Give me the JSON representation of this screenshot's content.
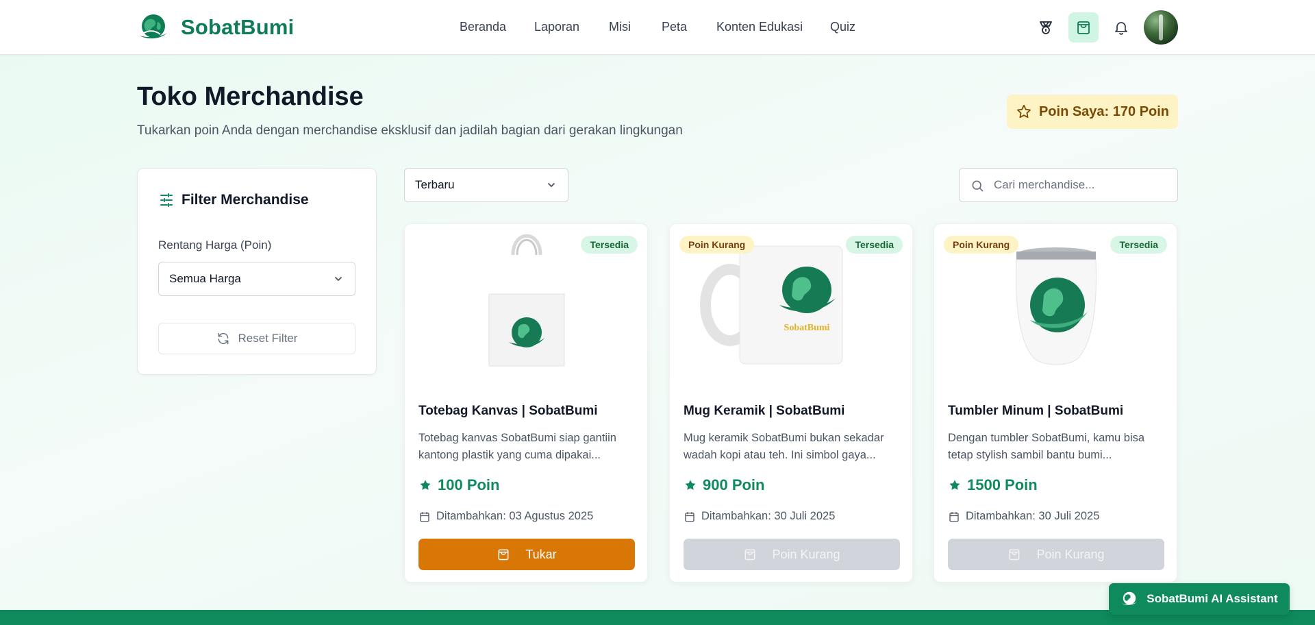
{
  "brand": {
    "name": "SobatBumi",
    "color": "#0e7c55"
  },
  "nav": {
    "items": [
      {
        "label": "Beranda"
      },
      {
        "label": "Laporan"
      },
      {
        "label": "Misi"
      },
      {
        "label": "Peta"
      },
      {
        "label": "Konten Edukasi"
      },
      {
        "label": "Quiz"
      }
    ]
  },
  "header_icons": [
    "badge-icon",
    "shopping-bag-icon",
    "bell-icon",
    "avatar"
  ],
  "page": {
    "title": "Toko Merchandise",
    "subtitle": "Tukarkan poin Anda dengan merchandise eksklusif dan jadilah bagian dari gerakan lingkungan",
    "points_label": "Poin Saya: 170 Poin"
  },
  "filter": {
    "title": "Filter Merchandise",
    "price_label": "Rentang Harga (Poin)",
    "price_value": "Semua Harga",
    "reset_label": "Reset Filter"
  },
  "sort": {
    "value": "Terbaru"
  },
  "search": {
    "placeholder": "Cari merchandise..."
  },
  "products": [
    {
      "name": "Totebag Kanvas | SobatBumi",
      "desc": "Totebag kanvas SobatBumi siap gantiin kantong plastik yang cuma dipakai...",
      "price": "100 Poin",
      "date": "Ditambahkan: 03 Agustus 2025",
      "status": "Tersedia",
      "warning": "",
      "button": "Tukar",
      "image": "totebag"
    },
    {
      "name": "Mug Keramik | SobatBumi",
      "desc": "Mug keramik SobatBumi bukan sekadar wadah kopi atau teh. Ini simbol gaya...",
      "price": "900 Poin",
      "date": "Ditambahkan: 30 Juli 2025",
      "status": "Tersedia",
      "warning": "Poin Kurang",
      "button": "Poin Kurang",
      "image": "mug",
      "mug_text": "SobatBumi"
    },
    {
      "name": "Tumbler Minum | SobatBumi",
      "desc": "Dengan tumbler SobatBumi, kamu bisa tetap stylish sambil bantu bumi...",
      "price": "1500 Poin",
      "date": "Ditambahkan: 30 Juli 2025",
      "status": "Tersedia",
      "warning": "Poin Kurang",
      "button": "Poin Kurang",
      "image": "tumbler"
    }
  ],
  "assistant": {
    "label": "SobatBumi AI Assistant"
  },
  "colors": {
    "primary": "#0e8a5c",
    "accent_orange": "#d97706",
    "badge_yellow": "#fdf3c4",
    "badge_green": "#d8f6e6",
    "disabled": "#d1d5db"
  }
}
